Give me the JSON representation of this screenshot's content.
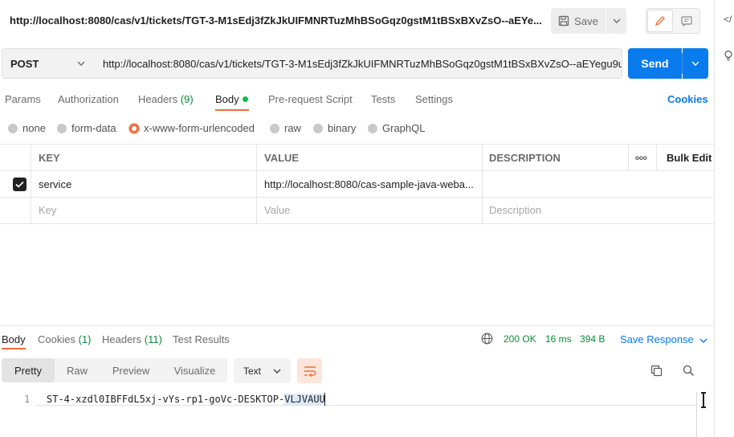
{
  "request": {
    "title": "http://localhost:8080/cas/v1/tickets/TGT-3-M1sEdj3fZkJkUIFMNRTuzMhBSoGqz0gstM1tBSxBXvZsO--aEYe...",
    "save_label": "Save",
    "method": "POST",
    "url": "http://localhost:8080/cas/v1/tickets/TGT-3-M1sEdj3fZkJkUIFMNRTuzMhBSoGqz0gstM1tBSxBXvZsO--aEYegu9u",
    "send_label": "Send"
  },
  "request_tabs": {
    "params": "Params",
    "authorization": "Authorization",
    "headers": "Headers",
    "headers_count": "(9)",
    "body": "Body",
    "prerequest": "Pre-request Script",
    "tests": "Tests",
    "settings": "Settings",
    "cookies": "Cookies"
  },
  "body_types": {
    "none": "none",
    "form_data": "form-data",
    "urlencoded": "x-www-form-urlencoded",
    "raw": "raw",
    "binary": "binary",
    "graphql": "GraphQL",
    "selected": "x-www-form-urlencoded"
  },
  "params_table": {
    "headers": {
      "key": "KEY",
      "value": "VALUE",
      "description": "DESCRIPTION",
      "more": "ooo",
      "bulk_edit": "Bulk Edit"
    },
    "rows": [
      {
        "checked": true,
        "key": "service",
        "value": "http://localhost:8080/cas-sample-java-weba...",
        "description": ""
      }
    ],
    "placeholder": {
      "key": "Key",
      "value": "Value",
      "description": "Description"
    }
  },
  "response": {
    "tabs": {
      "body": "Body",
      "cookies": "Cookies",
      "cookies_count": "(1)",
      "headers": "Headers",
      "headers_count": "(11)",
      "test_results": "Test Results"
    },
    "status": "200 OK",
    "time": "16 ms",
    "size": "394 B",
    "save_response": "Save Response",
    "view_modes": {
      "pretty": "Pretty",
      "raw": "Raw",
      "preview": "Preview",
      "visualize": "Visualize"
    },
    "format": "Text",
    "line_number": "1",
    "body_text_plain": "ST-4-xzdl0IBFFdL5xj-vYs-rp1-goVc-DESKTOP-",
    "body_text_highlight": "VLJVAUU"
  },
  "colors": {
    "accent": "#097bed",
    "active_tab": "#f26b3a",
    "success": "#0b8a3a"
  },
  "icons": {
    "save": "floppy-disk-icon",
    "edit": "pencil-icon",
    "comment": "comment-icon",
    "environment": "globe-icon",
    "wrap": "wrap-lines-icon",
    "copy": "copy-icon",
    "search": "search-icon"
  }
}
